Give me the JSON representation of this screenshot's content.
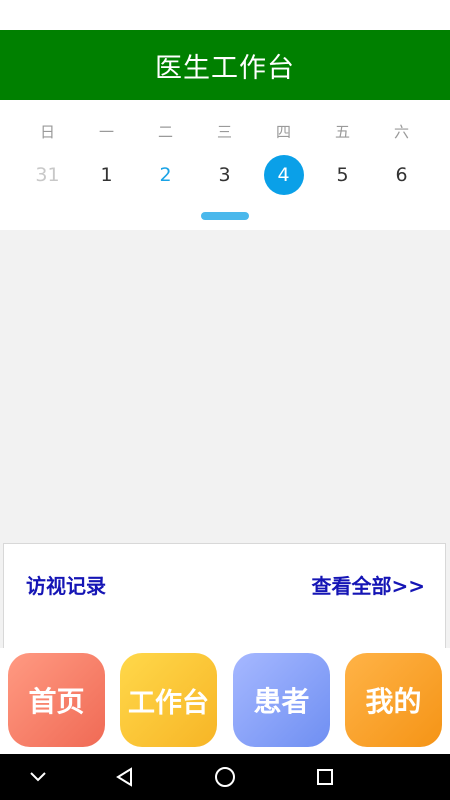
{
  "header": {
    "title": "医生工作台"
  },
  "calendar": {
    "weekdays": [
      "日",
      "一",
      "二",
      "三",
      "四",
      "五",
      "六"
    ],
    "dates": [
      "31",
      "1",
      "2",
      "3",
      "4",
      "5",
      "6"
    ]
  },
  "visit_card": {
    "title": "访视记录",
    "view_all": "查看全部>>"
  },
  "bottom_nav": {
    "home": "首页",
    "workbench": "工作台",
    "patients": "患者",
    "mine": "我的"
  },
  "colors": {
    "header_bg": "#008000",
    "selected_date": "#0aa0e8",
    "card_text": "#1515b5"
  },
  "system_nav": {
    "icons": [
      "chevron-down-icon",
      "back-triangle-icon",
      "home-circle-icon",
      "recents-square-icon"
    ]
  }
}
